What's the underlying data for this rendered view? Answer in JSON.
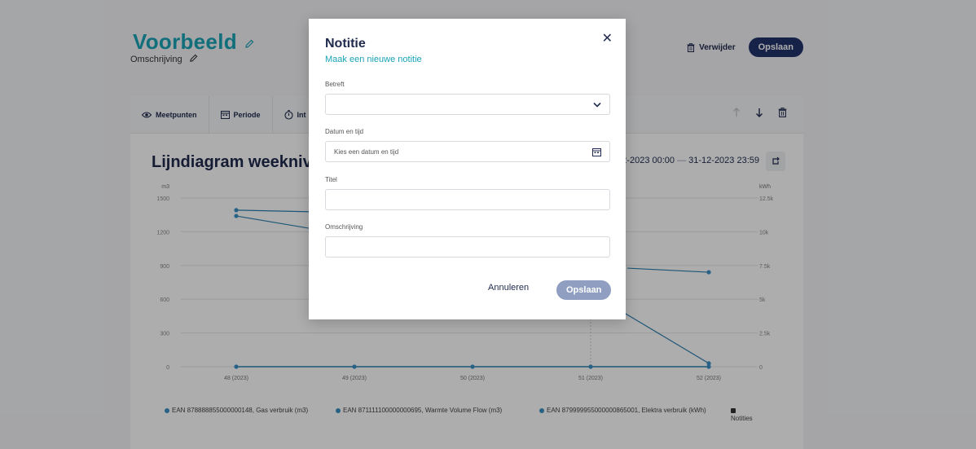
{
  "header": {
    "title": "Voorbeeld",
    "subtitle": "Omschrijving",
    "delete_label": "Verwijder",
    "save_label": "Opslaan"
  },
  "toolbar": {
    "items": [
      {
        "label": "Meetpunten",
        "icon": "eye-icon"
      },
      {
        "label": "Periode",
        "icon": "calendar-icon"
      },
      {
        "label": "Int",
        "icon": "timer-icon"
      }
    ]
  },
  "chart": {
    "title": "Lijndiagram weekniv",
    "date_from": "12-2023 00:00",
    "date_sep": "—",
    "date_to": "31-12-2023 23:59",
    "left_unit": "m3",
    "right_unit": "kWh"
  },
  "chart_data": {
    "type": "line",
    "categories": [
      "48 (2023)",
      "49 (2023)",
      "50 (2023)",
      "51 (2023)",
      "52 (2023)"
    ],
    "y_left": {
      "label": "m3",
      "ticks": [
        "0",
        "300",
        "600",
        "900",
        "1200",
        "1500"
      ],
      "ylim": [
        0,
        1500
      ]
    },
    "y_right": {
      "label": "kWh",
      "ticks": [
        "0",
        "2.5k",
        "5k",
        "7.5k",
        "10k",
        "12.5k"
      ],
      "ylim": [
        0,
        12500
      ]
    },
    "series": [
      {
        "name": "EAN 878888855000000148, Gas verbruik (m3)",
        "axis": "left",
        "color": "#2a7fb0",
        "values": [
          1340,
          null,
          null,
          null,
          30
        ]
      },
      {
        "name": "EAN 871111100000000695, Warmte Volume Flow (m3)",
        "axis": "left",
        "color": "#2a7fb0",
        "values": [
          0,
          0,
          0,
          0,
          0
        ]
      },
      {
        "name": "EAN 879999955000000865001, Elektra verbruik (kWh)",
        "axis": "right",
        "color": "#2a7fb0",
        "values": [
          11600,
          null,
          null,
          null,
          7000
        ]
      }
    ],
    "grid": true,
    "legend": "bottom"
  },
  "legend": [
    {
      "text": "EAN 878888855000000148, Gas verbruik (m3)",
      "color": "#3a8fc4"
    },
    {
      "text": "EAN 871111100000000695, Warmte Volume Flow (m3)",
      "color": "#3a8fc4"
    },
    {
      "text": "EAN 879999955000000865001, Elektra verbruik (kWh)",
      "color": "#3a8fc4"
    },
    {
      "text": "Notities",
      "color": "#333333"
    }
  ],
  "modal": {
    "title": "Notitie",
    "subtitle": "Maak een nieuwe notitie",
    "betreft_label": "Betreft",
    "betreft_value": "",
    "datetime_label": "Datum en tijd",
    "datetime_placeholder": "Kies een datum en tijd",
    "titel_label": "Titel",
    "titel_value": "",
    "omschrijving_label": "Omschrijving",
    "omschrijving_value": "",
    "cancel_label": "Annuleren",
    "save_label": "Opslaan"
  }
}
